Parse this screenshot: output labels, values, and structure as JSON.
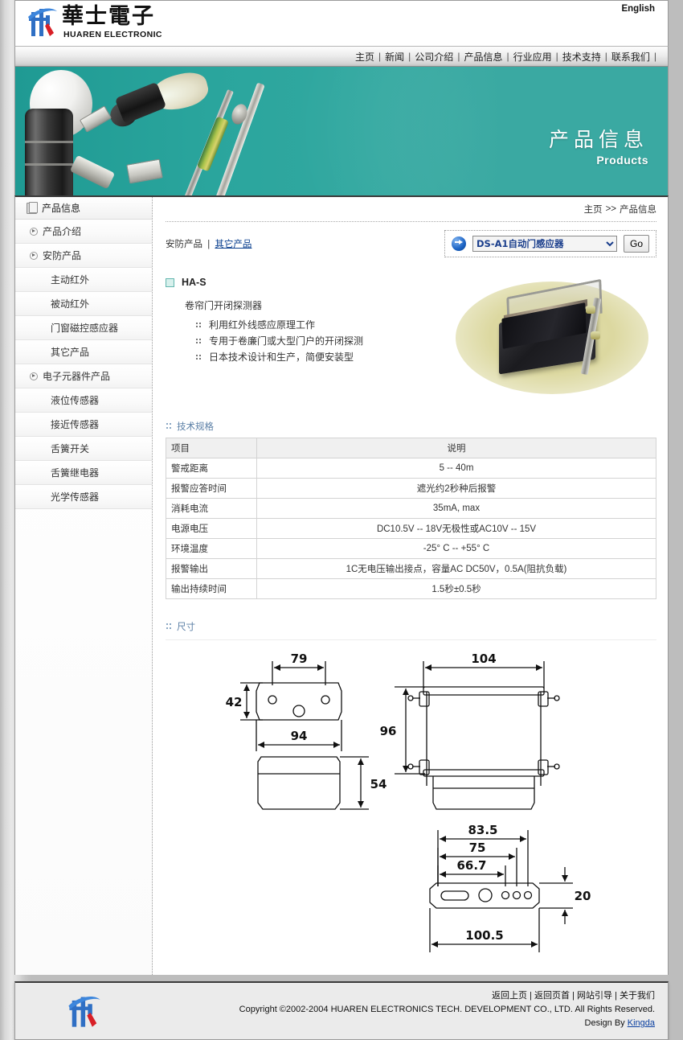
{
  "site": {
    "logo_cn": "華士電子",
    "logo_en": "HUAREN ELECTRONIC",
    "english_link": "English"
  },
  "nav": {
    "items": [
      {
        "label": "主页"
      },
      {
        "label": "新闻"
      },
      {
        "label": "公司介绍"
      },
      {
        "label": "产品信息"
      },
      {
        "label": "行业应用"
      },
      {
        "label": "技术支持"
      },
      {
        "label": "联系我们"
      }
    ],
    "separator": "|"
  },
  "banner": {
    "title_cn": "产品信息",
    "title_en": "Products"
  },
  "sidebar": {
    "header": "产品信息",
    "items": [
      {
        "label": "产品介绍",
        "level": 1
      },
      {
        "label": "安防产品",
        "level": 1
      },
      {
        "label": "主动红外",
        "level": 2
      },
      {
        "label": "被动红外",
        "level": 2
      },
      {
        "label": "门窗磁控感应器",
        "level": 2
      },
      {
        "label": "其它产品",
        "level": 2
      },
      {
        "label": "电子元器件产品",
        "level": 1
      },
      {
        "label": "液位传感器",
        "level": 2
      },
      {
        "label": "接近传感器",
        "level": 2
      },
      {
        "label": "舌簧开关",
        "level": 2
      },
      {
        "label": "舌簧继电器",
        "level": 2
      },
      {
        "label": "光学传感器",
        "level": 2
      }
    ]
  },
  "breadcrumb": {
    "home": "主页",
    "separator": ">>",
    "current": "产品信息"
  },
  "subnav": {
    "category": "安防产品",
    "divider": "|",
    "subcategory": "其它产品"
  },
  "selector": {
    "selected": "DS-A1自动门感应器",
    "options": [
      "DS-A1自动门感应器"
    ],
    "go_label": "Go"
  },
  "product": {
    "model": "HA-S",
    "subtitle": "卷帘门开闭探测器",
    "features": [
      "利用红外线感应原理工作",
      "专用于卷廉门或大型门户的开闭探测",
      "日本技术设计和生产，简便安装型"
    ]
  },
  "spec_section": {
    "heading": "技术规格",
    "columns": [
      "项目",
      "说明"
    ],
    "rows": [
      {
        "item": "警戒距离",
        "value": "5 -- 40m"
      },
      {
        "item": "报警应答时间",
        "value": "遮光约2秒种后报警"
      },
      {
        "item": "消耗电流",
        "value": "35mA, max"
      },
      {
        "item": "电源电压",
        "value": "DC10.5V -- 18V无极性或AC10V -- 15V"
      },
      {
        "item": "环境温度",
        "value": "-25° C -- +55° C"
      },
      {
        "item": "报警输出",
        "value": "1C无电压输出接点，容量AC DC50V，0.5A(阻抗负载)"
      },
      {
        "item": "输出持续时间",
        "value": "1.5秒±0.5秒"
      }
    ]
  },
  "dimension_section": {
    "heading": "尺寸",
    "labels": {
      "front_width_inner": "79",
      "front_height": "42",
      "front_width_outer": "94",
      "side_height": "54",
      "back_width": "104",
      "back_height": "96",
      "bracket_width_a": "83.5",
      "bracket_width_b": "75",
      "bracket_width_c": "66.7",
      "bracket_height": "20",
      "bracket_width_total": "100.5"
    }
  },
  "footer": {
    "links": [
      "返回上页",
      "返回页首",
      "网站引导",
      "关于我们"
    ],
    "separator": "|",
    "copyright": "Copyright ©2002-2004 HUAREN ELECTRONICS TECH. DEVELOPMENT CO., LTD. All Rights Reserved.",
    "design_by_label": "Design By",
    "design_by_name": "Kingda"
  }
}
